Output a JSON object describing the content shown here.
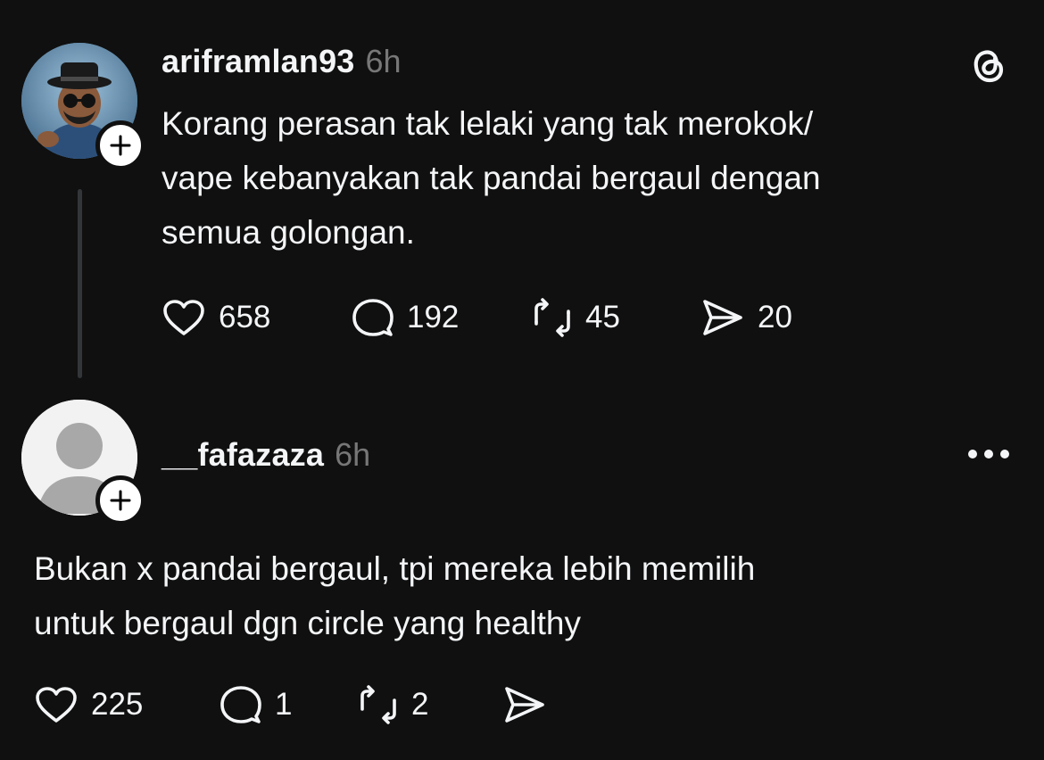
{
  "post": {
    "username": "ariframlan93",
    "time": "6h",
    "text_line1": "Korang perasan tak lelaki yang tak merokok/",
    "text_line2": "vape kebanyakan tak pandai bergaul dengan",
    "text_line3": "semua golongan.",
    "likes": "658",
    "replies": "192",
    "reposts": "45",
    "shares": "20"
  },
  "reply": {
    "username": "__fafazaza",
    "time": "6h",
    "text_line1": "Bukan x pandai bergaul, tpi mereka lebih memilih",
    "text_line2": "untuk bergaul dgn circle yang healthy",
    "likes": "225",
    "replies": "1",
    "reposts": "2"
  },
  "colors": {
    "background": "#101010",
    "text": "#f3f5f7",
    "muted": "#777777",
    "thread_line": "#333638"
  }
}
